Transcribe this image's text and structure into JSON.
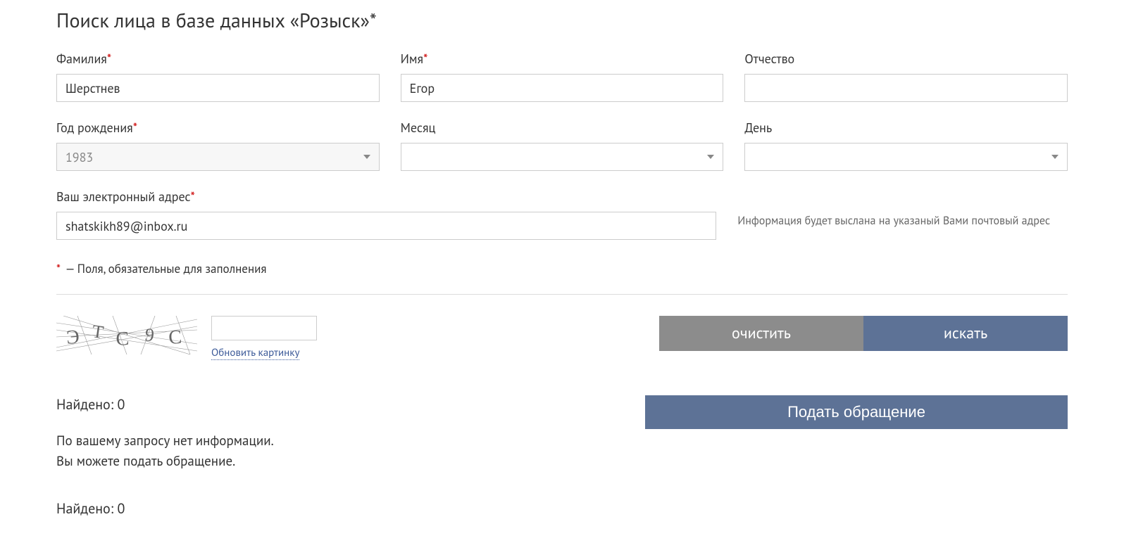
{
  "title": "Поиск лица в базе данных «Розыск»*",
  "fields": {
    "lastname_label": "Фамилия",
    "lastname_value": "Шерстнев",
    "firstname_label": "Имя",
    "firstname_value": "Егор",
    "patronymic_label": "Отчество",
    "patronymic_value": "",
    "year_label": "Год рождения",
    "year_value": "1983",
    "month_label": "Месяц",
    "month_value": "",
    "day_label": "День",
    "day_value": "",
    "email_label": "Ваш электронный адрес",
    "email_value": "shatskikh89@inbox.ru"
  },
  "email_note": "Информация будет выслана на указаный Вами почтовый адрес",
  "required_note": "— Поля, обязательные для заполнения",
  "captcha": {
    "refresh": "Обновить картинку"
  },
  "buttons": {
    "clear": "очистить",
    "search": "искать",
    "appeal": "Подать обращение"
  },
  "results": {
    "found_label": "Найдено: ",
    "found_count": "0",
    "no_info_line1": "По вашему запросу нет информации.",
    "no_info_line2": "Вы можете подать обращение.",
    "found_label2": "Найдено: ",
    "found_count2": "0"
  }
}
